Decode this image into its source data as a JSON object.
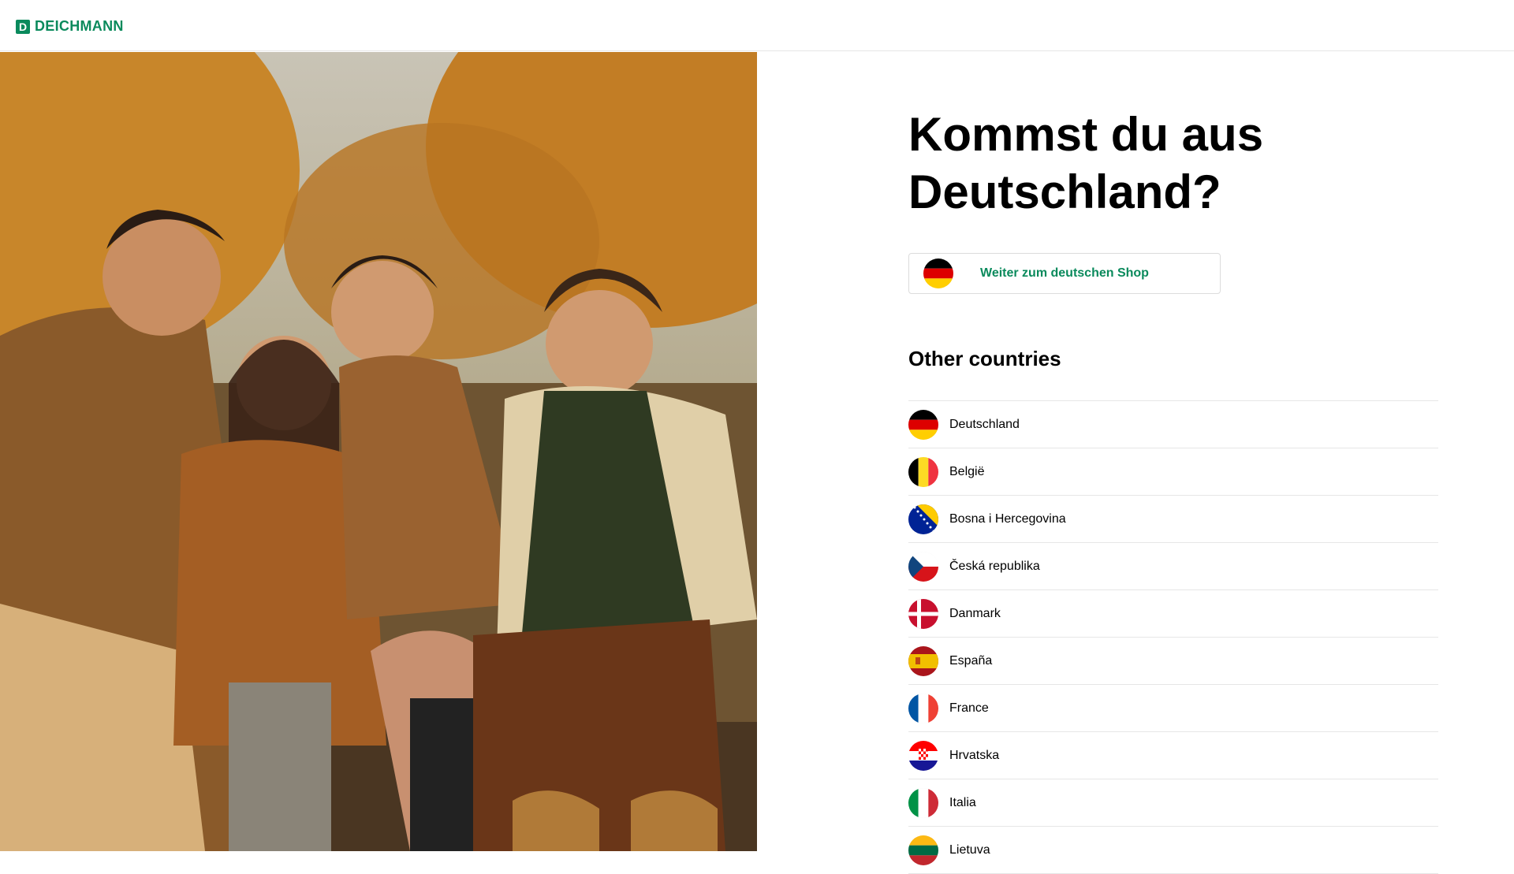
{
  "header": {
    "logo_text": "DEICHMANN",
    "logo_mark": "D"
  },
  "hero": {
    "image": "family-autumn-photo"
  },
  "main": {
    "title": "Kommst du aus Deutschland?",
    "primary_button": {
      "label": "Weiter zum deutschen Shop",
      "flag": "de-flag-icon"
    },
    "other_heading": "Other countries",
    "countries": [
      {
        "label": "Deutschland",
        "flag": "de-flag-icon"
      },
      {
        "label": "België",
        "flag": "be-flag-icon"
      },
      {
        "label": "Bosna i Hercegovina",
        "flag": "ba-flag-icon"
      },
      {
        "label": "Česká republika",
        "flag": "cz-flag-icon"
      },
      {
        "label": "Danmark",
        "flag": "dk-flag-icon"
      },
      {
        "label": "España",
        "flag": "es-flag-icon"
      },
      {
        "label": "France",
        "flag": "fr-flag-icon"
      },
      {
        "label": "Hrvatska",
        "flag": "hr-flag-icon"
      },
      {
        "label": "Italia",
        "flag": "it-flag-icon"
      },
      {
        "label": "Lietuva",
        "flag": "lt-flag-icon"
      }
    ]
  },
  "colors": {
    "brand": "#0a8a5c",
    "divider": "#e6e6e6"
  }
}
